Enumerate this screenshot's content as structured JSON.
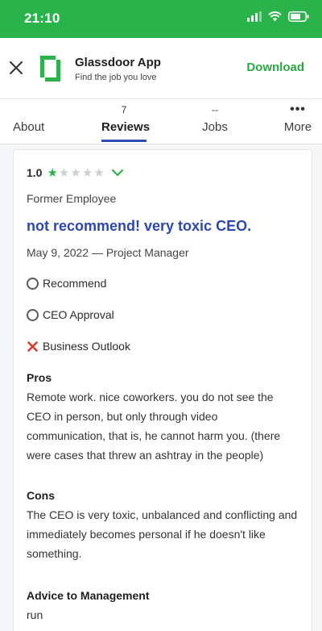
{
  "status_bar": {
    "time": "21:10"
  },
  "app_banner": {
    "name": "Glassdoor App",
    "subtitle": "Find the job you love",
    "download_label": "Download",
    "brand_color": "#2ab34b"
  },
  "tabs": [
    {
      "label": "About",
      "count": ""
    },
    {
      "label": "Reviews",
      "count": "7",
      "active": true
    },
    {
      "label": "Jobs",
      "count": "--"
    },
    {
      "label": "More",
      "count": ""
    }
  ],
  "review": {
    "rating": "1.0",
    "stars_filled": 1,
    "stars_total": 5,
    "employment": "Former Employee",
    "title": "not recommend! very toxic CEO.",
    "meta": "May 9, 2022 — Project Manager",
    "indicators": [
      {
        "label": "Recommend",
        "icon": "neutral-circle-icon"
      },
      {
        "label": "CEO Approval",
        "icon": "neutral-circle-icon"
      },
      {
        "label": "Business Outlook",
        "icon": "red-x-icon"
      }
    ],
    "pros_heading": "Pros",
    "pros_lines": [
      "Remote work. nice coworkers. you do not see the",
      "CEO in person, but only through video",
      "communication, that is, he cannot harm you. (there",
      "were cases that threw an ashtray in the people)"
    ],
    "cons_heading": "Cons",
    "cons_lines": [
      "The CEO is very toxic, unbalanced and conflicting and",
      "immediately becomes personal if he doesn't like",
      "something."
    ],
    "advice_heading": "Advice to Management",
    "advice_lines": [
      "run"
    ]
  },
  "colors": {
    "accent_blue": "#2d46b0",
    "star_green": "#2ab34b",
    "negative_red": "#d93a2b"
  }
}
